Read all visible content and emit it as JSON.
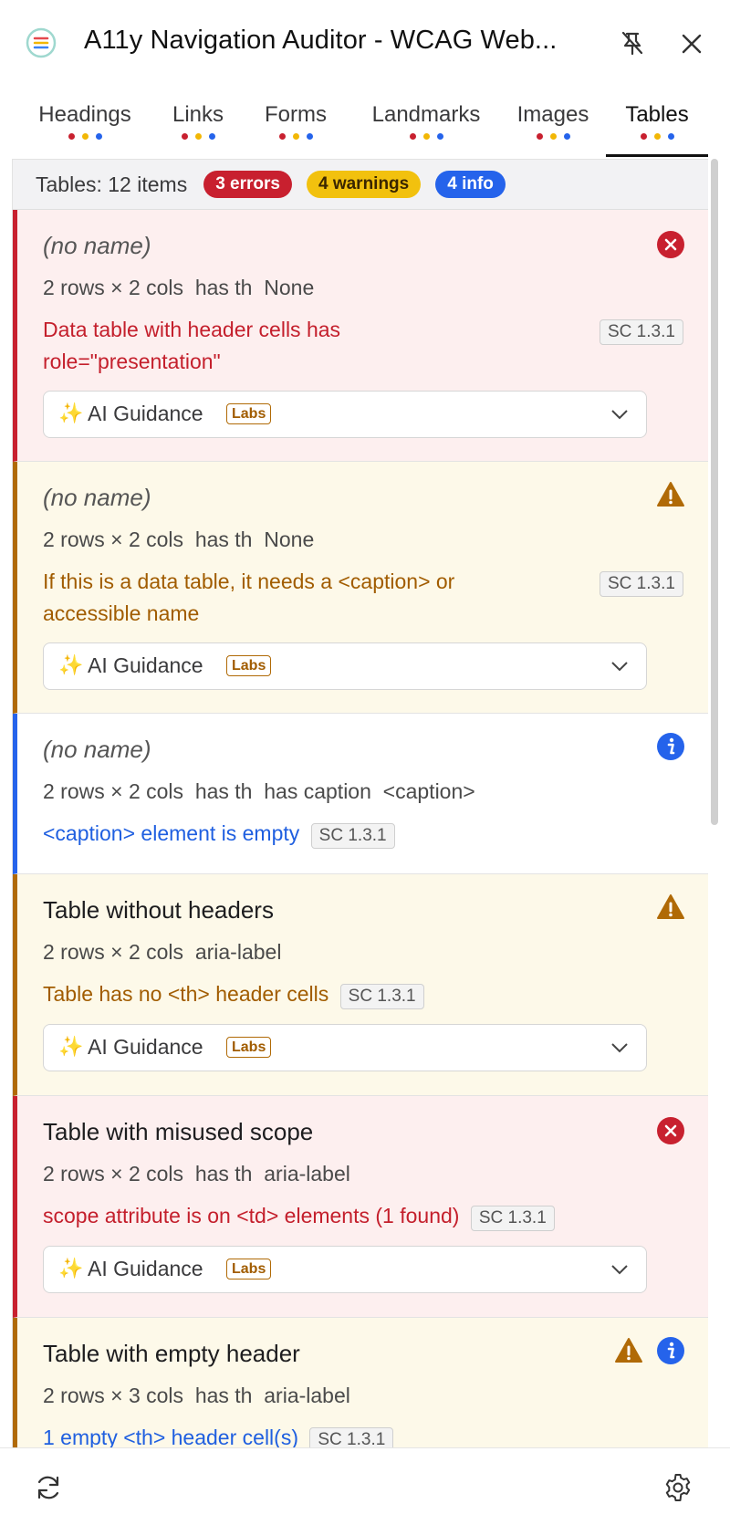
{
  "header": {
    "title": "A11y Navigation Auditor - WCAG Web..."
  },
  "tabs": [
    {
      "label": "Headings"
    },
    {
      "label": "Links"
    },
    {
      "label": "Forms"
    },
    {
      "label": "Landmarks"
    },
    {
      "label": "Images"
    },
    {
      "label": "Tables",
      "active": true
    }
  ],
  "summary": {
    "label": "Tables: 12 items",
    "errors": "3 errors",
    "warnings": "4 warnings",
    "info": "4 info"
  },
  "guidance": {
    "label": "AI Guidance",
    "labs": "Labs"
  },
  "items": [
    {
      "severity": "error",
      "name": "(no name)",
      "meta": "2 rows × 2 cols  has th  None",
      "message": "Data table with header cells has role=\"presentation\"",
      "sc": "SC 1.3.1"
    },
    {
      "severity": "warning",
      "name": "(no name)",
      "meta": "2 rows × 2 cols  has th  None",
      "message": "If this is a data table, it needs a <caption> or accessible name",
      "sc": "SC 1.3.1"
    },
    {
      "severity": "info",
      "name": "(no name)",
      "meta": "2 rows × 2 cols  has th  has caption  <caption>",
      "message": "<caption> element is empty",
      "sc": "SC 1.3.1"
    },
    {
      "severity": "warning",
      "name": "Table without headers",
      "meta": "2 rows × 2 cols  aria-label",
      "message": "Table has no <th> header cells",
      "sc": "SC 1.3.1"
    },
    {
      "severity": "error",
      "name": "Table with misused scope",
      "meta": "2 rows × 2 cols  has th  aria-label",
      "message": "scope attribute is on <td> elements (1 found)",
      "sc": "SC 1.3.1"
    },
    {
      "severity": "warning",
      "name": "Table with empty header",
      "meta": "2 rows × 3 cols  has th  aria-label",
      "message": "1 empty <th> header cell(s)",
      "sc": "SC 1.3.1"
    }
  ],
  "colors": {
    "error": "#c8202f",
    "warning": "#b06a06",
    "info": "#2563eb"
  },
  "icons": [
    "logo-icon",
    "pin-off-icon",
    "close-icon",
    "error-icon",
    "warning-icon",
    "info-icon",
    "sparkle-icon",
    "chevron-down-icon",
    "refresh-icon",
    "settings-icon"
  ]
}
